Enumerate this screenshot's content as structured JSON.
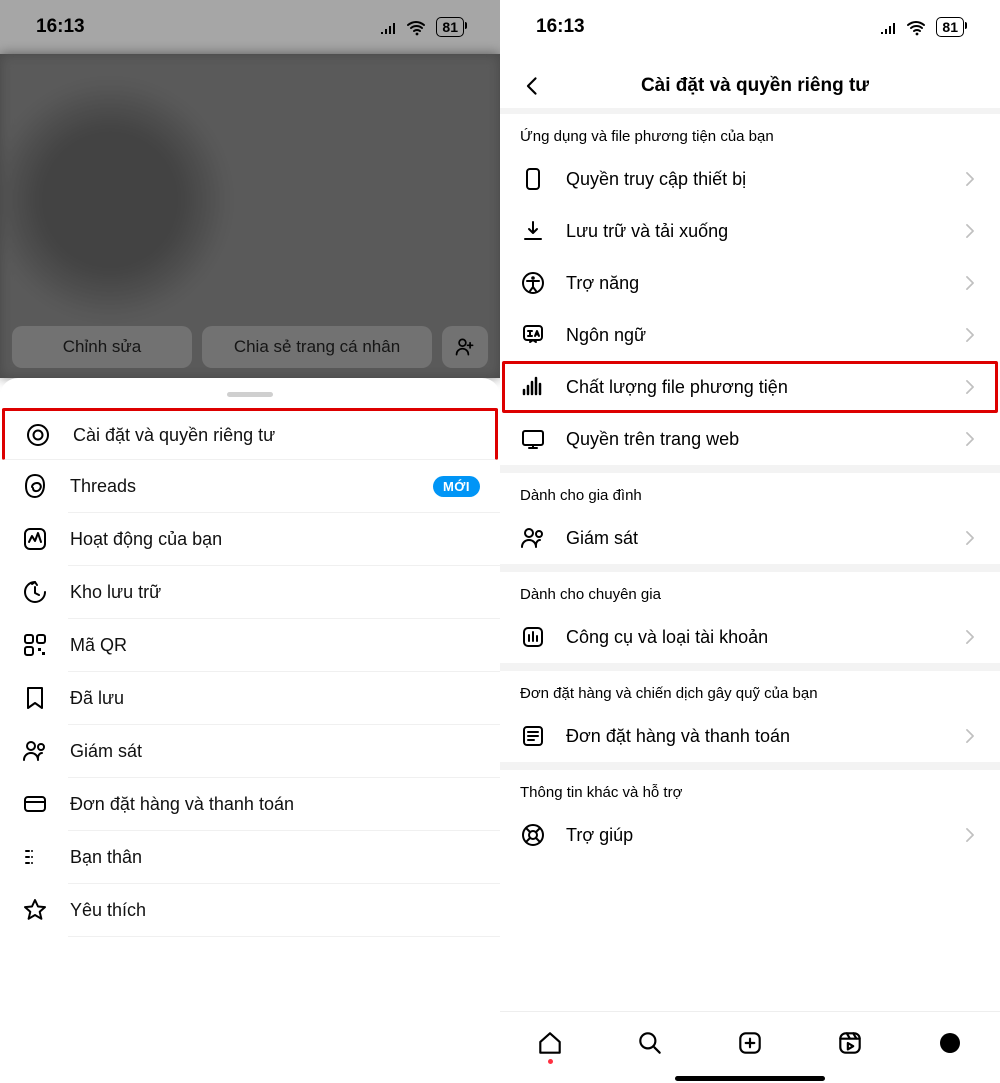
{
  "status": {
    "time": "16:13",
    "battery": "81"
  },
  "left": {
    "profile_buttons": {
      "edit": "Chỉnh sửa",
      "share": "Chia sẻ trang cá nhân"
    },
    "menu": [
      {
        "key": "settings",
        "label": "Cài đặt và quyền riêng tư",
        "highlight": true
      },
      {
        "key": "threads",
        "label": "Threads",
        "badge": "MỚI"
      },
      {
        "key": "activity",
        "label": "Hoạt động của bạn"
      },
      {
        "key": "archive",
        "label": "Kho lưu trữ"
      },
      {
        "key": "qr",
        "label": "Mã QR"
      },
      {
        "key": "saved",
        "label": "Đã lưu"
      },
      {
        "key": "supervise",
        "label": "Giám sát"
      },
      {
        "key": "orders",
        "label": "Đơn đặt hàng và thanh toán"
      },
      {
        "key": "close",
        "label": "Bạn thân"
      },
      {
        "key": "fav",
        "label": "Yêu thích"
      }
    ]
  },
  "right": {
    "title": "Cài đặt và quyền riêng tư",
    "sections": [
      {
        "head": "Ứng dụng và file phương tiện của bạn",
        "items": [
          {
            "key": "device",
            "label": "Quyền truy cập thiết bị"
          },
          {
            "key": "download",
            "label": "Lưu trữ và tải xuống"
          },
          {
            "key": "access",
            "label": "Trợ năng"
          },
          {
            "key": "lang",
            "label": "Ngôn ngữ"
          },
          {
            "key": "media",
            "label": "Chất lượng file phương tiện",
            "highlight": true
          },
          {
            "key": "web",
            "label": "Quyền trên trang web"
          }
        ]
      },
      {
        "head": "Dành cho gia đình",
        "items": [
          {
            "key": "supervise2",
            "label": "Giám sát"
          }
        ]
      },
      {
        "head": "Dành cho chuyên gia",
        "items": [
          {
            "key": "tools",
            "label": "Công cụ và loại tài khoản"
          }
        ]
      },
      {
        "head": "Đơn đặt hàng và chiến dịch gây quỹ của bạn",
        "items": [
          {
            "key": "orders2",
            "label": "Đơn đặt hàng và thanh toán"
          }
        ]
      },
      {
        "head": "Thông tin khác và hỗ trợ",
        "items": [
          {
            "key": "help",
            "label": "Trợ giúp"
          }
        ]
      }
    ]
  }
}
